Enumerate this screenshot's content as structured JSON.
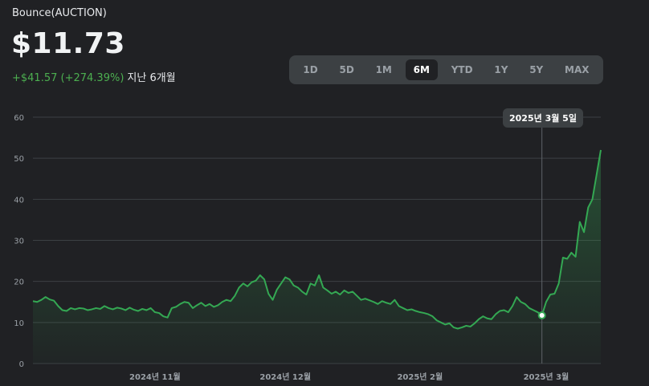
{
  "asset": {
    "name": "Bounce(AUCTION)",
    "price": "$11.73",
    "change": "+$41.57 (+274.39%)",
    "period": "지난 6개월"
  },
  "range_tabs": [
    {
      "label": "1D",
      "active": false
    },
    {
      "label": "5D",
      "active": false
    },
    {
      "label": "1M",
      "active": false
    },
    {
      "label": "6M",
      "active": true
    },
    {
      "label": "YTD",
      "active": false
    },
    {
      "label": "1Y",
      "active": false
    },
    {
      "label": "5Y",
      "active": false
    },
    {
      "label": "MAX",
      "active": false
    }
  ],
  "tooltip": {
    "label": "2025년 3월 5일",
    "value": 11.73
  },
  "colors": {
    "line": "#34a853",
    "grid": "#3c4043",
    "axis_text": "#9aa0a6"
  },
  "chart_data": {
    "type": "area",
    "ylim": [
      0,
      60
    ],
    "y_ticks": [
      "0",
      "10",
      "20",
      "30",
      "40",
      "50",
      "60"
    ],
    "x_ticks": [
      "2024년 11월",
      "2024년 12월",
      "2025년 2월",
      "2025년 3월"
    ],
    "x_tick_index": [
      29,
      60,
      92,
      122
    ],
    "values": [
      15.2,
      15.0,
      15.5,
      16.2,
      15.6,
      15.3,
      14.0,
      13.0,
      12.8,
      13.5,
      13.2,
      13.5,
      13.4,
      13.0,
      13.2,
      13.5,
      13.3,
      14.0,
      13.5,
      13.2,
      13.6,
      13.4,
      13.0,
      13.6,
      13.1,
      12.8,
      13.3,
      13.0,
      13.5,
      12.5,
      12.3,
      11.5,
      11.2,
      13.5,
      13.8,
      14.5,
      15.0,
      14.8,
      13.5,
      14.2,
      14.8,
      14.0,
      14.5,
      13.8,
      14.2,
      15.0,
      15.5,
      15.2,
      16.5,
      18.5,
      19.5,
      18.8,
      19.8,
      20.2,
      21.5,
      20.5,
      17.0,
      15.5,
      18.0,
      19.5,
      21.0,
      20.5,
      19.0,
      18.5,
      17.5,
      16.8,
      19.5,
      19.0,
      21.5,
      18.5,
      17.8,
      17.0,
      17.5,
      16.8,
      17.8,
      17.2,
      17.5,
      16.5,
      15.5,
      15.8,
      15.4,
      15.0,
      14.5,
      15.2,
      14.8,
      14.5,
      15.5,
      14.0,
      13.5,
      13.0,
      13.2,
      12.8,
      12.5,
      12.3,
      12.0,
      11.5,
      10.5,
      10.0,
      9.5,
      9.8,
      8.8,
      8.5,
      8.8,
      9.2,
      9.0,
      9.8,
      10.8,
      11.5,
      11.0,
      10.8,
      12.0,
      12.8,
      13.0,
      12.5,
      14.0,
      16.2,
      15.0,
      14.5,
      13.5,
      13.0,
      12.5,
      11.73,
      15.0,
      16.8,
      17.0,
      19.5,
      25.8,
      25.5,
      27.0,
      26.0,
      34.5,
      32.0,
      38.0,
      40.0,
      46.0,
      52.0
    ],
    "highlight_index": 121
  }
}
